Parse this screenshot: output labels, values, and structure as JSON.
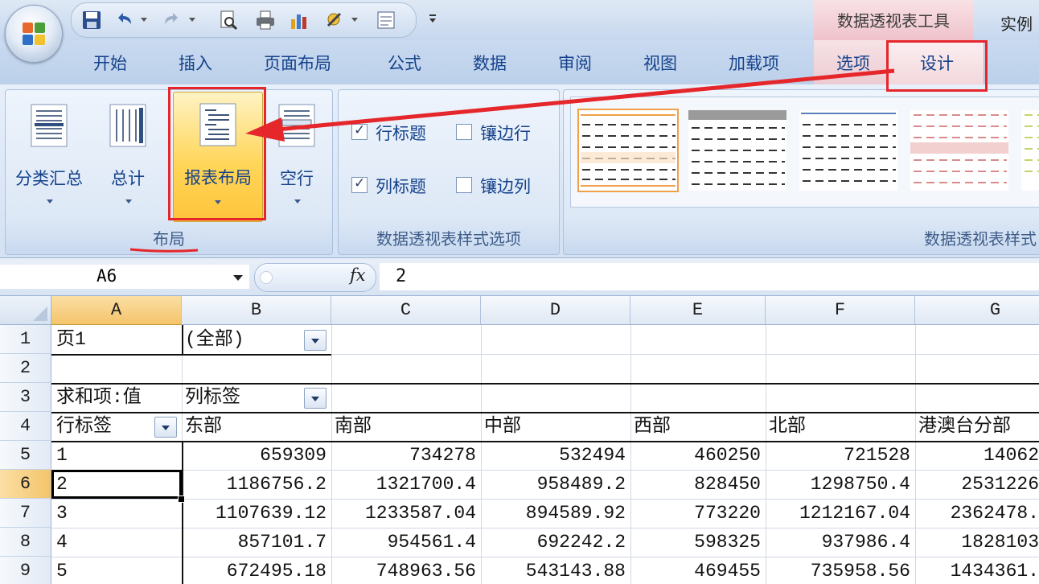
{
  "title_bar": {
    "contextual_tab_header": "数据透视表工具",
    "document_title": "实例",
    "quick_access_icons": [
      "save-icon",
      "undo-icon",
      "redo-icon",
      "print-preview-icon",
      "print-icon",
      "chart-icon",
      "tools-icon",
      "form-icon"
    ]
  },
  "tabs": [
    "开始",
    "插入",
    "页面布局",
    "公式",
    "数据",
    "审阅",
    "视图",
    "加载项",
    "选项",
    "设计"
  ],
  "active_tab": "设计",
  "ribbon": {
    "layout_group": {
      "label": "布局",
      "buttons": [
        {
          "label": "分类汇总",
          "icon": "subtotals-icon"
        },
        {
          "label": "总计",
          "icon": "grand-totals-icon"
        },
        {
          "label": "报表布局",
          "icon": "report-layout-icon"
        },
        {
          "label": "空行",
          "icon": "blank-rows-icon"
        }
      ]
    },
    "style_options_group": {
      "label": "数据透视表样式选项",
      "checkboxes": [
        {
          "label": "行标题",
          "checked": true
        },
        {
          "label": "镶边行",
          "checked": false
        },
        {
          "label": "列标题",
          "checked": true
        },
        {
          "label": "镶边列",
          "checked": false
        }
      ]
    },
    "styles_group": {
      "label": "数据透视表样式",
      "accent_colors": [
        "#f0a04b",
        "#808080",
        "#5b7fb8",
        "#d98b8b",
        "#c5d36b"
      ]
    }
  },
  "formula_bar": {
    "name_box": "A6",
    "fx_label": "fx",
    "formula": "2"
  },
  "sheet": {
    "columns": [
      "A",
      "B",
      "C",
      "D",
      "E",
      "F",
      "G"
    ],
    "row_numbers": [
      "1",
      "2",
      "3",
      "4",
      "5",
      "6",
      "7",
      "8",
      "9"
    ],
    "selected_column": "A",
    "selected_row": "6",
    "row1": {
      "a": "页1",
      "b": "(全部)"
    },
    "row3": {
      "a": "求和项:值",
      "b": "列标签"
    },
    "row4": {
      "a": "行标签",
      "headers": [
        "东部",
        "南部",
        "中部",
        "西部",
        "北部",
        "港澳台分部"
      ]
    },
    "data_rows": [
      {
        "label": "1",
        "values": [
          "659309",
          "734278",
          "532494",
          "460250",
          "721528",
          "14062"
        ]
      },
      {
        "label": "2",
        "values": [
          "1186756.2",
          "1321700.4",
          "958489.2",
          "828450",
          "1298750.4",
          "2531226"
        ]
      },
      {
        "label": "3",
        "values": [
          "1107639.12",
          "1233587.04",
          "894589.92",
          "773220",
          "1212167.04",
          "2362478."
        ]
      },
      {
        "label": "4",
        "values": [
          "857101.7",
          "954561.4",
          "692242.2",
          "598325",
          "937986.4",
          "1828103"
        ]
      },
      {
        "label": "5",
        "values": [
          "672495.18",
          "748963.56",
          "543143.88",
          "469455",
          "735958.56",
          "1434361."
        ]
      }
    ]
  },
  "annotation_color": "#e5262b"
}
